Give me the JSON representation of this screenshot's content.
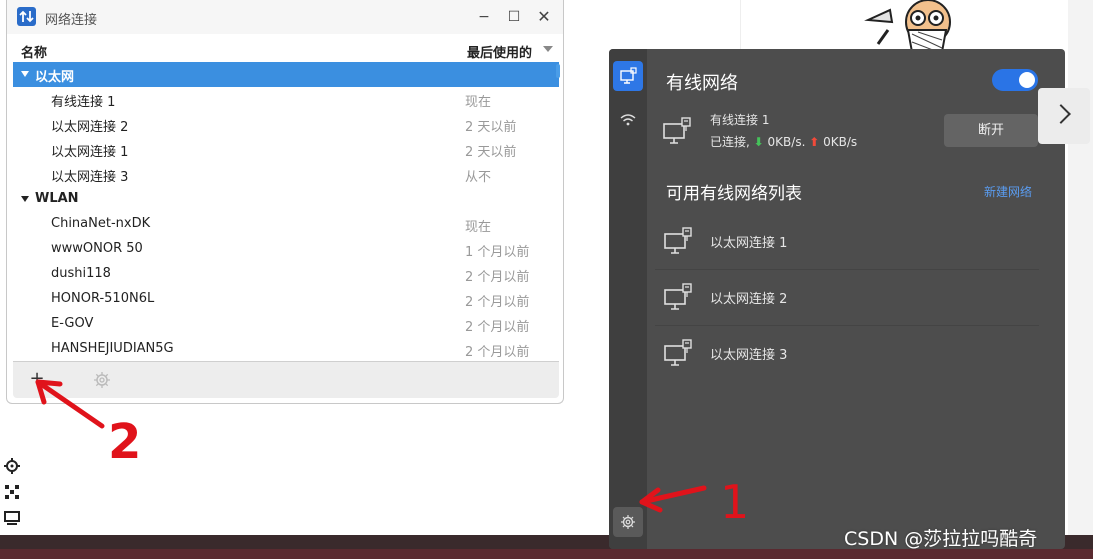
{
  "window": {
    "title": "网络连接",
    "min_label": "−",
    "max_label": "☐",
    "close_label": "✕"
  },
  "columns": {
    "name": "名称",
    "last_used": "最后使用的"
  },
  "groups": [
    {
      "label": "以太网",
      "selected": true,
      "connections": [
        {
          "name": "有线连接 1",
          "last_used": "现在"
        },
        {
          "name": "以太网连接 2",
          "last_used": "2 天以前"
        },
        {
          "name": "以太网连接 1",
          "last_used": "2 天以前"
        },
        {
          "name": "以太网连接 3",
          "last_used": "从不"
        }
      ]
    },
    {
      "label": "WLAN",
      "selected": false,
      "connections": [
        {
          "name": "ChinaNet-nxDK",
          "last_used": "现在"
        },
        {
          "name": "wwwONOR 50",
          "last_used": "1 个月以前"
        },
        {
          "name": "dushi118",
          "last_used": "2 个月以前"
        },
        {
          "name": "HONOR-510N6L",
          "last_used": "2 个月以前"
        },
        {
          "name": "E-GOV",
          "last_used": "2 个月以前"
        },
        {
          "name": "HANSHEJIUDIAN5G",
          "last_used": "2 个月以前"
        }
      ]
    }
  ],
  "toolbar": {
    "add_label": "+"
  },
  "panel": {
    "title": "有线网络",
    "toggle_on": true,
    "active": {
      "name": "有线连接 1",
      "status_prefix": "已连接,",
      "down_arrow": "⬇",
      "down_speed": "0KB/s.",
      "up_arrow": "⬆",
      "up_speed": "0KB/s"
    },
    "disconnect_label": "断开",
    "list_heading": "可用有线网络列表",
    "new_network_label": "新建网络",
    "available": [
      "以太网连接 1",
      "以太网连接 2",
      "以太网连接 3"
    ]
  },
  "annotations": {
    "label_1": "1",
    "label_2": "2"
  },
  "watermark": "CSDN @莎拉拉吗酷奇",
  "colors": {
    "accent": "#2e77e6",
    "selection": "#3b8fe0",
    "panel_bg": "#4d4d4d",
    "annotation": "#e0131b",
    "download": "#45c25a",
    "upload": "#f04a3a"
  },
  "icons": {
    "app": "network-swap-icon",
    "wired": "wired-network-icon",
    "wifi": "wifi-icon",
    "settings": "gear-icon",
    "add": "plus-icon",
    "expand": "chevron-right-icon"
  }
}
